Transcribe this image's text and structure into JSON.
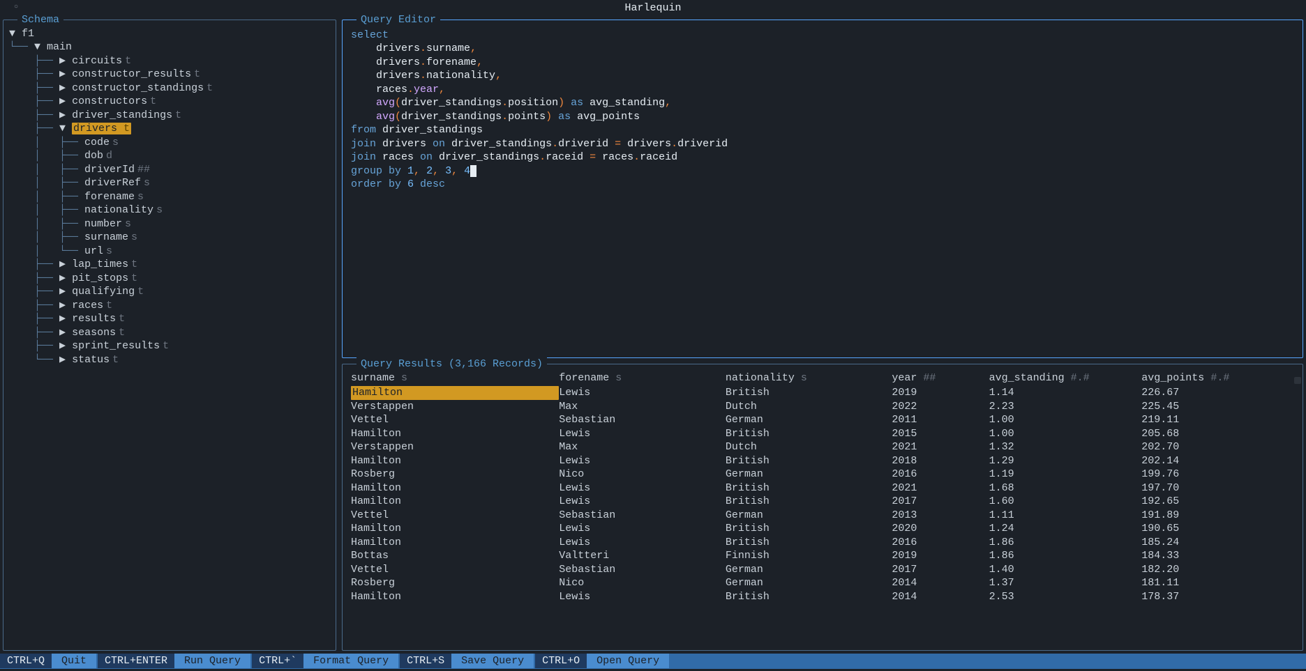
{
  "app_title": "Harlequin",
  "panels": {
    "schema_title": "Schema",
    "editor_title": "Query Editor",
    "results_title": "Query Results (3,166 Records)"
  },
  "schema": {
    "db": "f1",
    "schema_name": "main",
    "tables": [
      {
        "name": "circuits",
        "type": "t",
        "expanded": false
      },
      {
        "name": "constructor_results",
        "type": "t",
        "expanded": false
      },
      {
        "name": "constructor_standings",
        "type": "t",
        "expanded": false
      },
      {
        "name": "constructors",
        "type": "t",
        "expanded": false
      },
      {
        "name": "driver_standings",
        "type": "t",
        "expanded": false
      },
      {
        "name": "drivers",
        "type": "t",
        "expanded": true,
        "selected": true,
        "columns": [
          {
            "name": "code",
            "type": "s"
          },
          {
            "name": "dob",
            "type": "d"
          },
          {
            "name": "driverId",
            "type": "##"
          },
          {
            "name": "driverRef",
            "type": "s"
          },
          {
            "name": "forename",
            "type": "s"
          },
          {
            "name": "nationality",
            "type": "s"
          },
          {
            "name": "number",
            "type": "s"
          },
          {
            "name": "surname",
            "type": "s"
          },
          {
            "name": "url",
            "type": "s"
          }
        ]
      },
      {
        "name": "lap_times",
        "type": "t",
        "expanded": false
      },
      {
        "name": "pit_stops",
        "type": "t",
        "expanded": false
      },
      {
        "name": "qualifying",
        "type": "t",
        "expanded": false
      },
      {
        "name": "races",
        "type": "t",
        "expanded": false
      },
      {
        "name": "results",
        "type": "t",
        "expanded": false
      },
      {
        "name": "seasons",
        "type": "t",
        "expanded": false
      },
      {
        "name": "sprint_results",
        "type": "t",
        "expanded": false
      },
      {
        "name": "status",
        "type": "t",
        "expanded": false
      }
    ]
  },
  "query": {
    "lines": [
      [
        {
          "t": "select",
          "c": "kw"
        }
      ],
      [
        {
          "t": "    drivers",
          "c": "plain"
        },
        {
          "t": ".",
          "c": "punct"
        },
        {
          "t": "surname",
          "c": "plain"
        },
        {
          "t": ",",
          "c": "punct"
        }
      ],
      [
        {
          "t": "    drivers",
          "c": "plain"
        },
        {
          "t": ".",
          "c": "punct"
        },
        {
          "t": "forename",
          "c": "plain"
        },
        {
          "t": ",",
          "c": "punct"
        }
      ],
      [
        {
          "t": "    drivers",
          "c": "plain"
        },
        {
          "t": ".",
          "c": "punct"
        },
        {
          "t": "nationality",
          "c": "plain"
        },
        {
          "t": ",",
          "c": "punct"
        }
      ],
      [
        {
          "t": "    races",
          "c": "plain"
        },
        {
          "t": ".",
          "c": "punct"
        },
        {
          "t": "year",
          "c": "fn"
        },
        {
          "t": ",",
          "c": "punct"
        }
      ],
      [
        {
          "t": "    ",
          "c": "plain"
        },
        {
          "t": "avg",
          "c": "fn"
        },
        {
          "t": "(",
          "c": "punct"
        },
        {
          "t": "driver_standings",
          "c": "plain"
        },
        {
          "t": ".",
          "c": "punct"
        },
        {
          "t": "position",
          "c": "plain"
        },
        {
          "t": ")",
          "c": "punct"
        },
        {
          "t": " as ",
          "c": "kw"
        },
        {
          "t": "avg_standing",
          "c": "plain"
        },
        {
          "t": ",",
          "c": "punct"
        }
      ],
      [
        {
          "t": "    ",
          "c": "plain"
        },
        {
          "t": "avg",
          "c": "fn"
        },
        {
          "t": "(",
          "c": "punct"
        },
        {
          "t": "driver_standings",
          "c": "plain"
        },
        {
          "t": ".",
          "c": "punct"
        },
        {
          "t": "points",
          "c": "plain"
        },
        {
          "t": ")",
          "c": "punct"
        },
        {
          "t": " as ",
          "c": "kw"
        },
        {
          "t": "avg_points",
          "c": "plain"
        }
      ],
      [
        {
          "t": "from",
          "c": "kw"
        },
        {
          "t": " driver_standings",
          "c": "plain"
        }
      ],
      [
        {
          "t": "join",
          "c": "kw"
        },
        {
          "t": " drivers ",
          "c": "plain"
        },
        {
          "t": "on",
          "c": "kw"
        },
        {
          "t": " driver_standings",
          "c": "plain"
        },
        {
          "t": ".",
          "c": "punct"
        },
        {
          "t": "driverid ",
          "c": "plain"
        },
        {
          "t": "=",
          "c": "punct"
        },
        {
          "t": " drivers",
          "c": "plain"
        },
        {
          "t": ".",
          "c": "punct"
        },
        {
          "t": "driverid",
          "c": "plain"
        }
      ],
      [
        {
          "t": "join",
          "c": "kw"
        },
        {
          "t": " races ",
          "c": "plain"
        },
        {
          "t": "on",
          "c": "kw"
        },
        {
          "t": " driver_standings",
          "c": "plain"
        },
        {
          "t": ".",
          "c": "punct"
        },
        {
          "t": "raceid ",
          "c": "plain"
        },
        {
          "t": "=",
          "c": "punct"
        },
        {
          "t": " races",
          "c": "plain"
        },
        {
          "t": ".",
          "c": "punct"
        },
        {
          "t": "raceid",
          "c": "plain"
        }
      ],
      [
        {
          "t": "group by",
          "c": "kw"
        },
        {
          "t": " ",
          "c": "plain"
        },
        {
          "t": "1",
          "c": "num"
        },
        {
          "t": ",",
          "c": "punct"
        },
        {
          "t": " ",
          "c": "plain"
        },
        {
          "t": "2",
          "c": "num"
        },
        {
          "t": ",",
          "c": "punct"
        },
        {
          "t": " ",
          "c": "plain"
        },
        {
          "t": "3",
          "c": "num"
        },
        {
          "t": ",",
          "c": "punct"
        },
        {
          "t": " ",
          "c": "plain"
        },
        {
          "t": "4",
          "c": "num"
        },
        {
          "t": " ",
          "c": "cursor"
        }
      ],
      [
        {
          "t": "order by",
          "c": "kw"
        },
        {
          "t": " ",
          "c": "plain"
        },
        {
          "t": "6",
          "c": "num"
        },
        {
          "t": " desc",
          "c": "kw"
        }
      ]
    ]
  },
  "results": {
    "columns": [
      {
        "name": "surname",
        "type": "s"
      },
      {
        "name": "forename",
        "type": "s"
      },
      {
        "name": "nationality",
        "type": "s"
      },
      {
        "name": "year",
        "type": "##"
      },
      {
        "name": "avg_standing",
        "type": "#.#"
      },
      {
        "name": "avg_points",
        "type": "#.#"
      }
    ],
    "rows": [
      {
        "surname": "Hamilton",
        "forename": "Lewis",
        "nationality": "British",
        "year": "2019",
        "avg_standing": "1.14",
        "avg_points": "226.67",
        "selected": true
      },
      {
        "surname": "Verstappen",
        "forename": "Max",
        "nationality": "Dutch",
        "year": "2022",
        "avg_standing": "2.23",
        "avg_points": "225.45"
      },
      {
        "surname": "Vettel",
        "forename": "Sebastian",
        "nationality": "German",
        "year": "2011",
        "avg_standing": "1.00",
        "avg_points": "219.11"
      },
      {
        "surname": "Hamilton",
        "forename": "Lewis",
        "nationality": "British",
        "year": "2015",
        "avg_standing": "1.00",
        "avg_points": "205.68"
      },
      {
        "surname": "Verstappen",
        "forename": "Max",
        "nationality": "Dutch",
        "year": "2021",
        "avg_standing": "1.32",
        "avg_points": "202.70"
      },
      {
        "surname": "Hamilton",
        "forename": "Lewis",
        "nationality": "British",
        "year": "2018",
        "avg_standing": "1.29",
        "avg_points": "202.14"
      },
      {
        "surname": "Rosberg",
        "forename": "Nico",
        "nationality": "German",
        "year": "2016",
        "avg_standing": "1.19",
        "avg_points": "199.76"
      },
      {
        "surname": "Hamilton",
        "forename": "Lewis",
        "nationality": "British",
        "year": "2021",
        "avg_standing": "1.68",
        "avg_points": "197.70"
      },
      {
        "surname": "Hamilton",
        "forename": "Lewis",
        "nationality": "British",
        "year": "2017",
        "avg_standing": "1.60",
        "avg_points": "192.65"
      },
      {
        "surname": "Vettel",
        "forename": "Sebastian",
        "nationality": "German",
        "year": "2013",
        "avg_standing": "1.11",
        "avg_points": "191.89"
      },
      {
        "surname": "Hamilton",
        "forename": "Lewis",
        "nationality": "British",
        "year": "2020",
        "avg_standing": "1.24",
        "avg_points": "190.65"
      },
      {
        "surname": "Hamilton",
        "forename": "Lewis",
        "nationality": "British",
        "year": "2016",
        "avg_standing": "1.86",
        "avg_points": "185.24"
      },
      {
        "surname": "Bottas",
        "forename": "Valtteri",
        "nationality": "Finnish",
        "year": "2019",
        "avg_standing": "1.86",
        "avg_points": "184.33"
      },
      {
        "surname": "Vettel",
        "forename": "Sebastian",
        "nationality": "German",
        "year": "2017",
        "avg_standing": "1.40",
        "avg_points": "182.20"
      },
      {
        "surname": "Rosberg",
        "forename": "Nico",
        "nationality": "German",
        "year": "2014",
        "avg_standing": "1.37",
        "avg_points": "181.11"
      },
      {
        "surname": "Hamilton",
        "forename": "Lewis",
        "nationality": "British",
        "year": "2014",
        "avg_standing": "2.53",
        "avg_points": "178.37"
      }
    ]
  },
  "footer": [
    {
      "key": "CTRL+Q",
      "action": "Quit"
    },
    {
      "key": "CTRL+ENTER",
      "action": "Run Query"
    },
    {
      "key": "CTRL+`",
      "action": "Format Query"
    },
    {
      "key": "CTRL+S",
      "action": "Save Query"
    },
    {
      "key": "CTRL+O",
      "action": "Open Query"
    }
  ]
}
